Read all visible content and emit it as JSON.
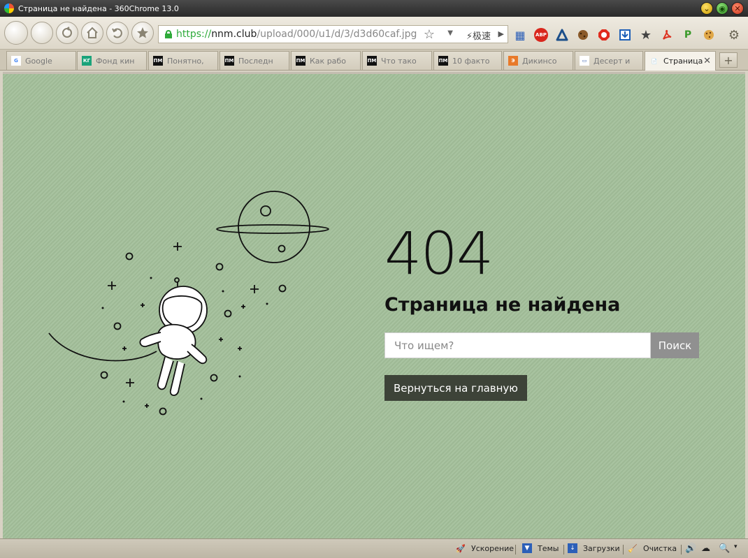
{
  "window": {
    "title": "Страница не найдена - 360Chrome 13.0",
    "controls": {
      "minimize": "⌄",
      "maximize": "◉",
      "close": "✕"
    }
  },
  "toolbar": {
    "url": {
      "protocol": "https://",
      "host": "nnm.club",
      "path": "/upload/000/u1/d/3/d3d60caf.jpg"
    },
    "speed_label": "极速",
    "extensions": [
      "apps-icon",
      "adblock-icon",
      "alice-icon",
      "cookie-icon",
      "stop-icon",
      "download-icon",
      "bookmark-star-icon",
      "pdf-icon",
      "paint-icon",
      "cookie2-icon"
    ],
    "abp_label": "ABP"
  },
  "tabs": [
    {
      "label": "Google",
      "favicon": "G",
      "fav_color": "#ffffff",
      "fav_text": "#4285f4"
    },
    {
      "label": "Фонд кин",
      "favicon": "КГ",
      "fav_color": "#1aa37a",
      "fav_text": "#ffffff"
    },
    {
      "label": "Понятно,",
      "favicon": "ПМ",
      "fav_color": "#111111",
      "fav_text": "#ffffff"
    },
    {
      "label": "Последн",
      "favicon": "ПМ",
      "fav_color": "#111111",
      "fav_text": "#ffffff"
    },
    {
      "label": "Как рабо",
      "favicon": "ПМ",
      "fav_color": "#111111",
      "fav_text": "#ffffff"
    },
    {
      "label": "Что тако",
      "favicon": "ПМ",
      "fav_color": "#111111",
      "fav_text": "#ffffff"
    },
    {
      "label": "10 факто",
      "favicon": "ПМ",
      "fav_color": "#111111",
      "fav_text": "#ffffff"
    },
    {
      "label": "Дикинсо",
      "favicon": "Э",
      "fav_color": "#e87a2a",
      "fav_text": "#ffffff"
    },
    {
      "label": "Десерт и",
      "favicon": "▭",
      "fav_color": "#ffffff",
      "fav_text": "#3a62b0"
    },
    {
      "label": "Страница",
      "favicon": "📄",
      "fav_color": "transparent",
      "fav_text": "#666666",
      "active": true
    }
  ],
  "page": {
    "error_code": "404",
    "heading": "Страница не найдена",
    "search": {
      "placeholder": "Что ищем?",
      "value": "",
      "button": "Поиск"
    },
    "home_button": "Вернуться на главную",
    "background": "#a3bf9a"
  },
  "statusbar": {
    "acceleration": "Ускорение",
    "themes": "Темы",
    "downloads": "Загрузки",
    "cleanup": "Очистка"
  }
}
